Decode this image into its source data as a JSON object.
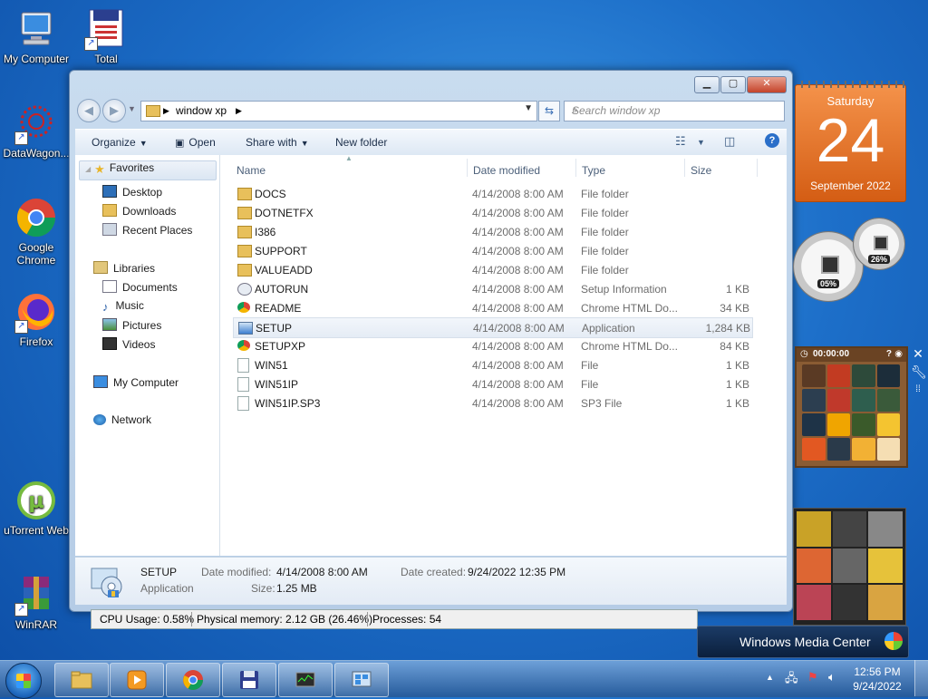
{
  "desktop": {
    "icons": [
      {
        "label": "My Computer",
        "icon": "computer-icon"
      },
      {
        "label": "Total",
        "icon": "floppy-doc-icon"
      },
      {
        "label": "DataWagon...",
        "icon": "datawagon-icon"
      },
      {
        "label": "Google Chrome",
        "icon": "chrome-icon"
      },
      {
        "label": "Firefox",
        "icon": "firefox-icon"
      },
      {
        "label": "uTorrent Web",
        "icon": "utorrent-icon"
      },
      {
        "label": "WinRAR",
        "icon": "winrar-icon"
      }
    ]
  },
  "explorer": {
    "address": {
      "crumb": "window xp"
    },
    "search_placeholder": "Search window xp",
    "toolbar": {
      "organize": "Organize",
      "open": "Open",
      "share_with": "Share with",
      "new_folder": "New folder"
    },
    "nav": {
      "favorites": "Favorites",
      "desktop": "Desktop",
      "downloads": "Downloads",
      "recent_places": "Recent Places",
      "libraries": "Libraries",
      "documents": "Documents",
      "music": "Music",
      "pictures": "Pictures",
      "videos": "Videos",
      "my_computer": "My Computer",
      "network": "Network"
    },
    "columns": {
      "name": "Name",
      "date": "Date modified",
      "type": "Type",
      "size": "Size"
    },
    "files": [
      {
        "name": "DOCS",
        "date": "4/14/2008 8:00 AM",
        "type": "File folder",
        "size": "",
        "icon": "folder-icon"
      },
      {
        "name": "DOTNETFX",
        "date": "4/14/2008 8:00 AM",
        "type": "File folder",
        "size": "",
        "icon": "folder-icon"
      },
      {
        "name": "I386",
        "date": "4/14/2008 8:00 AM",
        "type": "File folder",
        "size": "",
        "icon": "folder-icon"
      },
      {
        "name": "SUPPORT",
        "date": "4/14/2008 8:00 AM",
        "type": "File folder",
        "size": "",
        "icon": "folder-icon"
      },
      {
        "name": "VALUEADD",
        "date": "4/14/2008 8:00 AM",
        "type": "File folder",
        "size": "",
        "icon": "folder-icon"
      },
      {
        "name": "AUTORUN",
        "date": "4/14/2008 8:00 AM",
        "type": "Setup Information",
        "size": "1 KB",
        "icon": "setup-info-icon"
      },
      {
        "name": "README",
        "date": "4/14/2008 8:00 AM",
        "type": "Chrome HTML Do...",
        "size": "34 KB",
        "icon": "chrome-icon"
      },
      {
        "name": "SETUP",
        "date": "4/14/2008 8:00 AM",
        "type": "Application",
        "size": "1,284 KB",
        "icon": "setup-app-icon"
      },
      {
        "name": "SETUPXP",
        "date": "4/14/2008 8:00 AM",
        "type": "Chrome HTML Do...",
        "size": "84 KB",
        "icon": "chrome-icon"
      },
      {
        "name": "WIN51",
        "date": "4/14/2008 8:00 AM",
        "type": "File",
        "size": "1 KB",
        "icon": "file-icon"
      },
      {
        "name": "WIN51IP",
        "date": "4/14/2008 8:00 AM",
        "type": "File",
        "size": "1 KB",
        "icon": "file-icon"
      },
      {
        "name": "WIN51IP.SP3",
        "date": "4/14/2008 8:00 AM",
        "type": "SP3 File",
        "size": "1 KB",
        "icon": "file-icon"
      }
    ],
    "details": {
      "name": "SETUP",
      "type": "Application",
      "modified_label": "Date modified:",
      "modified": "4/14/2008 8:00 AM",
      "created_label": "Date created:",
      "created": "9/24/2022 12:35 PM",
      "size_label": "Size:",
      "size": "1.25 MB"
    }
  },
  "statusbar": {
    "cpu": "CPU Usage: 0.58%",
    "memory": "Physical memory: 2.12 GB (26.46%)",
    "processes": "Processes: 54"
  },
  "gadgets": {
    "calendar": {
      "weekday": "Saturday",
      "day": "24",
      "month": "September 2022"
    },
    "cpu_meter": {
      "cpu": "05%",
      "memory": "26%"
    },
    "puzzle": {
      "timer": "00:00:00"
    },
    "media_center": {
      "label": "Windows Media Center"
    }
  },
  "taskbar": {
    "clock_time": "12:56 PM",
    "clock_date": "9/24/2022"
  },
  "colors": {
    "accent": "#1d6fc9",
    "calendar": "#e8732b",
    "selection": "#e5ecf5"
  }
}
